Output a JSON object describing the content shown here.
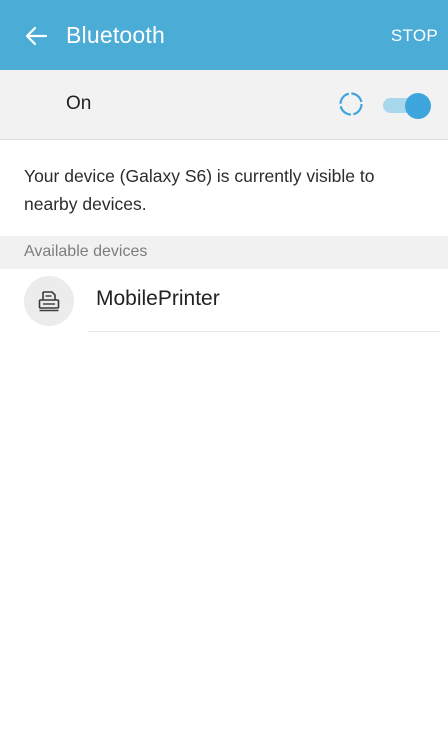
{
  "app_bar": {
    "title": "Bluetooth",
    "stop_label": "STOP",
    "back_icon": "arrow-left-icon",
    "background": "#4bacd6"
  },
  "master_switch": {
    "label": "On",
    "state": "on",
    "scanning": true,
    "accent_color": "#3ea6dd"
  },
  "visibility_message": "Your device (Galaxy S6) is currently visible to nearby devices.",
  "available_section": {
    "header": "Available devices",
    "devices": [
      {
        "name": "MobilePrinter",
        "icon": "printer-icon"
      }
    ]
  }
}
